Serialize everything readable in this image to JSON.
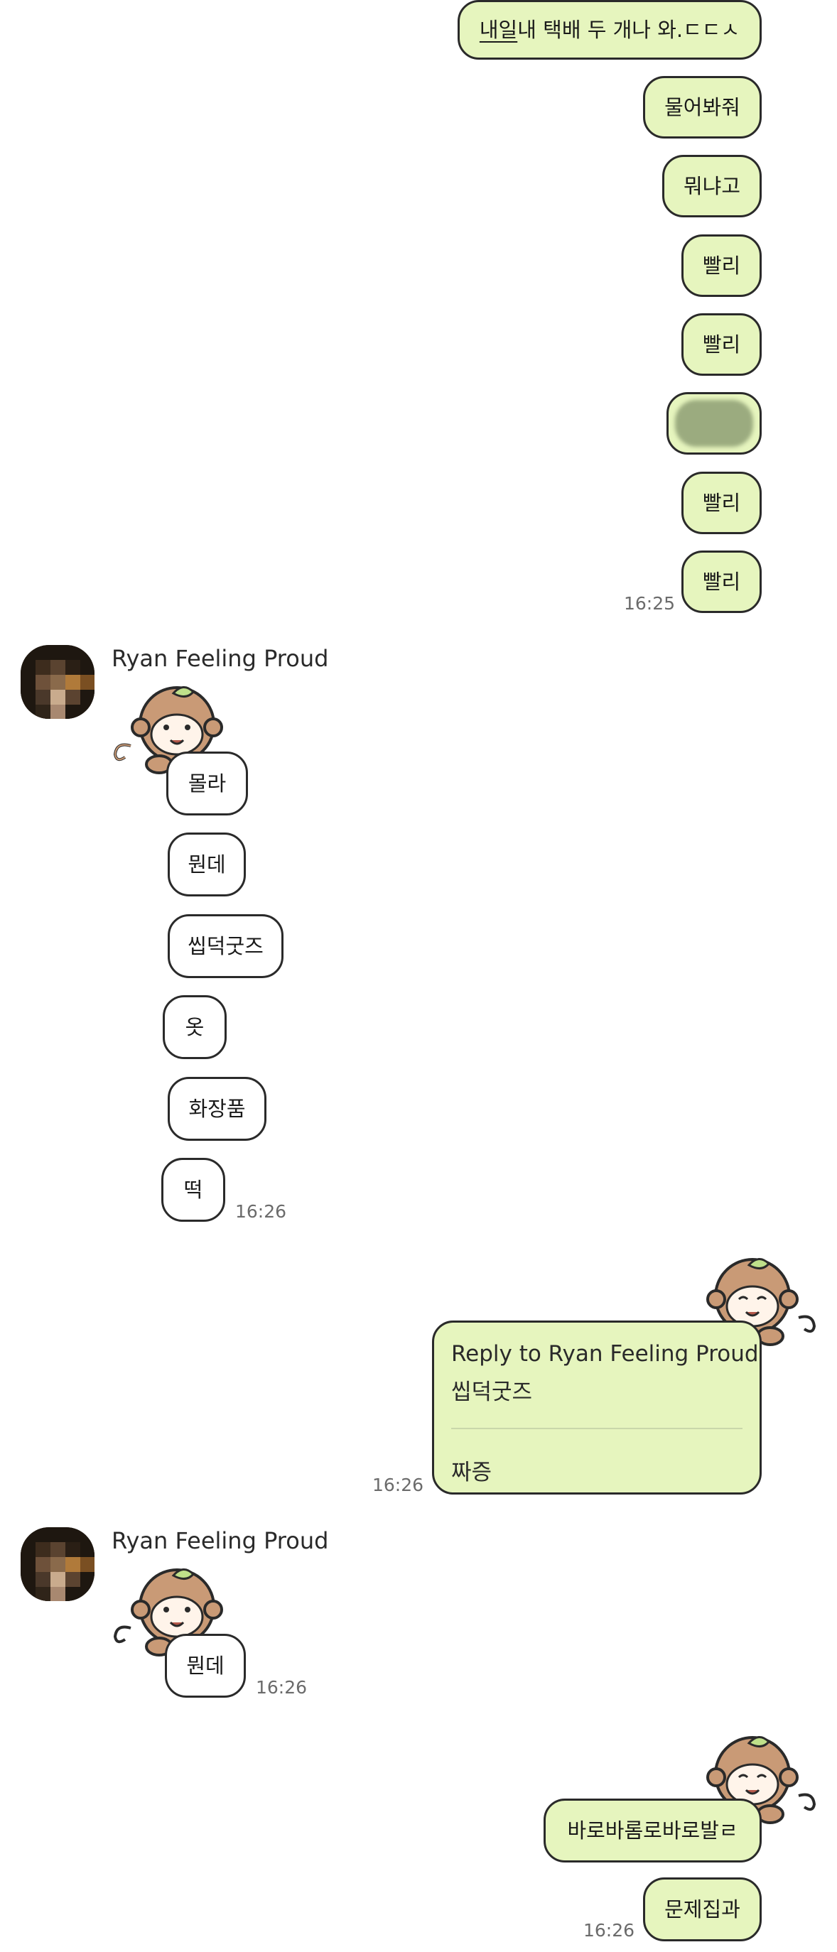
{
  "messages_top": [
    {
      "text_a": "내일",
      "text_b": " 내 택배 두 개나 와.ㄷㄷㅅ"
    },
    {
      "text": "물어봐줘"
    },
    {
      "text": "뭐냐고"
    },
    {
      "text": "빨리"
    },
    {
      "text": "빨리"
    },
    {
      "text": "빨리"
    },
    {
      "text": "빨리"
    }
  ],
  "time_1": "16:25",
  "sender_name": "Ryan Feeling Proud",
  "replies_1": [
    "몰라",
    "뭔데",
    "씹덕굿즈",
    "옷",
    "화장품",
    "떡"
  ],
  "time_2": "16:26",
  "reply_card": {
    "header": "Reply to Ryan Feeling Proud",
    "quoted": "씹덕굿즈",
    "message": "짜증"
  },
  "time_3": "16:26",
  "sender_name_2": "Ryan Feeling Proud",
  "reply_2": "뭔데",
  "time_4": "16:26",
  "messages_bottom": [
    "바로바롬로바로발ㄹ",
    "문제집과"
  ],
  "time_5": "16:26",
  "colors": {
    "my_bubble": "#e6f5be",
    "their_bubble": "#ffffff",
    "border": "#2a2a2a"
  },
  "sticker_icon": "monkey-with-leaf-sticker-icon"
}
